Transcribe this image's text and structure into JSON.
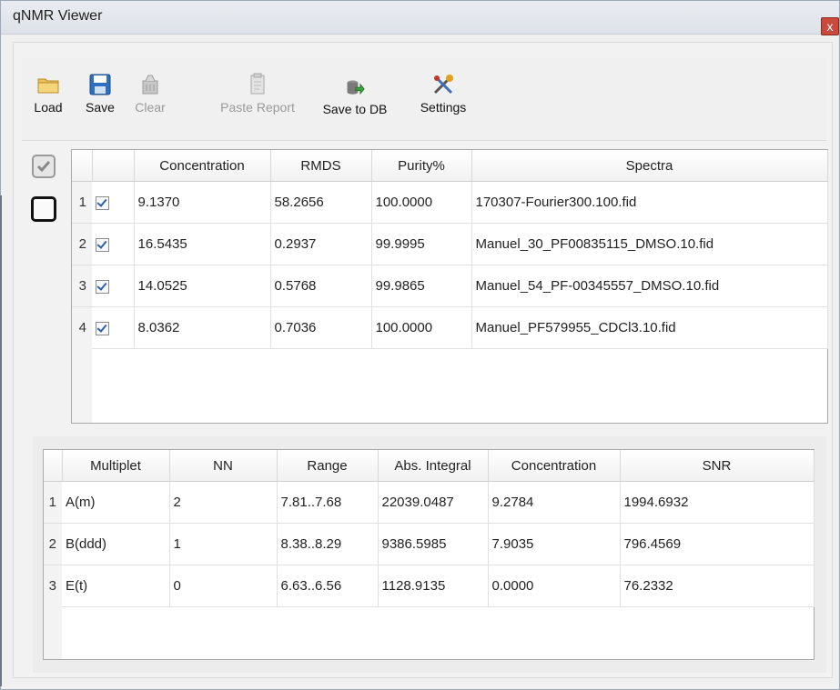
{
  "window": {
    "title": "qNMR Viewer",
    "close_label": "x"
  },
  "toolbar": {
    "buttons": [
      {
        "label": "Load",
        "icon": "folder-icon",
        "enabled": true
      },
      {
        "label": "Save",
        "icon": "floppy-disk-icon",
        "enabled": true
      },
      {
        "label": "Clear",
        "icon": "clear-icon",
        "enabled": false
      },
      {
        "label": "Paste Report",
        "icon": "paste-icon",
        "enabled": false
      },
      {
        "label": "Save to DB",
        "icon": "database-save-icon",
        "enabled": true
      },
      {
        "label": "Settings",
        "icon": "settings-tools-icon",
        "enabled": true
      }
    ]
  },
  "spectra_table": {
    "headers": [
      "",
      "",
      "Concentration",
      "RMDS",
      "Purity%",
      "Spectra"
    ],
    "rows": [
      {
        "n": "1",
        "checked": true,
        "concentration": "9.1370",
        "rmds": "58.2656",
        "purity": "100.0000",
        "spectra": "170307-Fourier300.100.fid"
      },
      {
        "n": "2",
        "checked": true,
        "concentration": "16.5435",
        "rmds": "0.2937",
        "purity": "99.9995",
        "spectra": "Manuel_30_PF00835115_DMSO.10.fid"
      },
      {
        "n": "3",
        "checked": true,
        "concentration": "14.0525",
        "rmds": "0.5768",
        "purity": "99.9865",
        "spectra": "Manuel_54_PF-00345557_DMSO.10.fid"
      },
      {
        "n": "4",
        "checked": true,
        "concentration": "8.0362",
        "rmds": "0.7036",
        "purity": "100.0000",
        "spectra": "Manuel_PF579955_CDCl3.10.fid"
      }
    ]
  },
  "multiplet_table": {
    "headers": [
      "",
      "Multiplet",
      "NN",
      "Range",
      "Abs. Integral",
      "Concentration",
      "SNR"
    ],
    "rows": [
      {
        "n": "1",
        "multiplet": "A(m)",
        "nn": "2",
        "range": "7.81..7.68",
        "abs_integral": "22039.0487",
        "concentration": "9.2784",
        "snr": "1994.6932"
      },
      {
        "n": "2",
        "multiplet": "B(ddd)",
        "nn": "1",
        "range": "8.38..8.29",
        "abs_integral": "9386.5985",
        "concentration": "7.9035",
        "snr": "796.4569"
      },
      {
        "n": "3",
        "multiplet": "E(t)",
        "nn": "0",
        "range": "6.63..6.56",
        "abs_integral": "1128.9135",
        "concentration": "0.0000",
        "snr": "76.2332"
      }
    ]
  }
}
